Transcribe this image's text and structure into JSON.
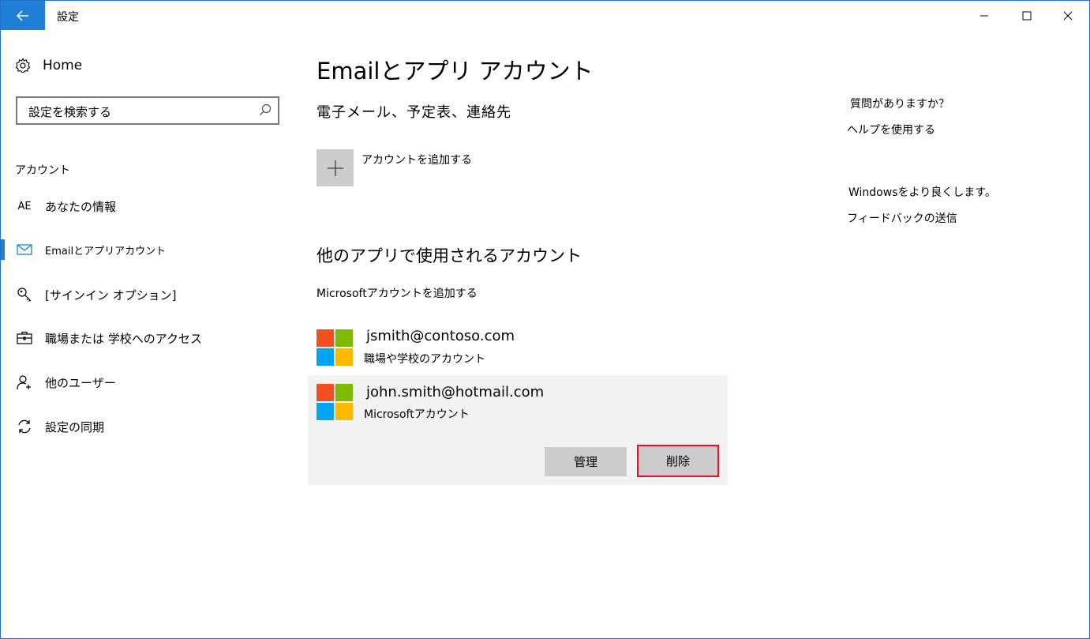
{
  "window": {
    "title": "設定",
    "controls": {
      "minimize": "minimize",
      "maximize": "maximize",
      "close": "close"
    }
  },
  "sidebar": {
    "home_label": "Home",
    "search": {
      "placeholder": "設定を検索する"
    },
    "section_label": "アカウント",
    "items": [
      {
        "icon_text": "AE",
        "label": "あなたの情報",
        "active": false
      },
      {
        "icon": "mail-icon",
        "label": "Emailとアプリアカウント",
        "active": true
      },
      {
        "icon": "key-icon",
        "label": "[サインイン オプション]",
        "active": false
      },
      {
        "icon": "briefcase-icon",
        "label": "職場または 学校へのアクセス",
        "active": false
      },
      {
        "icon": "person-add-icon",
        "label": "他のユーザー",
        "active": false
      },
      {
        "icon": "sync-icon",
        "label": "設定の同期",
        "active": false
      }
    ]
  },
  "main": {
    "title": "Emailとアプリ アカウント",
    "subtitle": "電子メール、予定表、連絡先",
    "add_account_label": "アカウントを追加する",
    "other_apps_heading": "他のアプリで使用されるアカウント",
    "add_ms_account_link": "Microsoftアカウントを追加する",
    "accounts": [
      {
        "email": "jsmith@contoso.com",
        "type": "職場や学校のアカウント"
      },
      {
        "email": "john.smith@hotmail.com",
        "type": "Microsoftアカウント"
      }
    ],
    "buttons": {
      "manage": "管理",
      "delete": "削除"
    }
  },
  "right_panel": {
    "question": "質問がありますか？",
    "help_link": "ヘルプを使用する",
    "improve": "Windowsをより良くします。",
    "feedback_link": "フィードバックの送信"
  },
  "colors": {
    "accent": "#1f7fd6",
    "ms_red": "#f25022",
    "ms_green": "#7fba00",
    "ms_blue": "#00a4ef",
    "ms_yellow": "#ffb900",
    "delete_border": "#e81123"
  }
}
